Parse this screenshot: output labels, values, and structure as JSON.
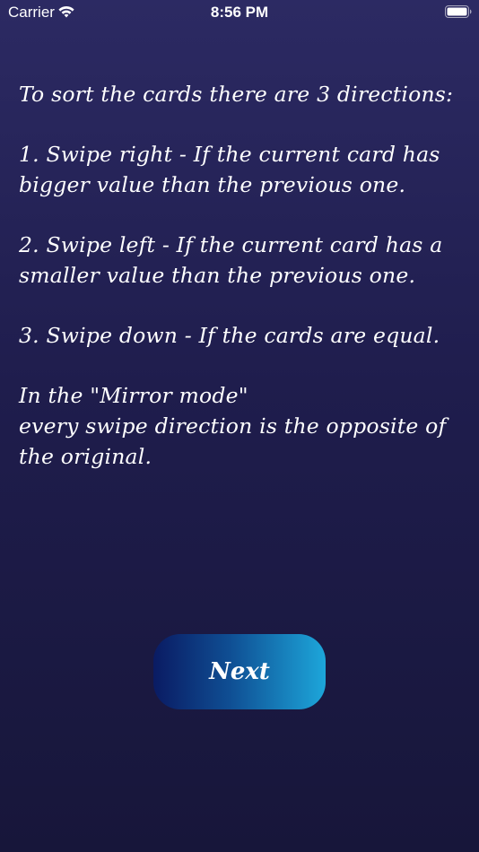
{
  "status_bar": {
    "carrier": "Carrier",
    "time": "8:56 PM",
    "wifi_icon": "wifi-icon",
    "battery_icon": "battery-icon"
  },
  "instructions": {
    "intro": "To sort the cards there are 3 directions:",
    "rule_1": "1. Swipe right - If the current card has bigger value than the previous one.",
    "rule_2": "2. Swipe left - If the current card has a smaller value than the previous one.",
    "rule_3": "3. Swipe down - If the cards are equal.",
    "mirror_line_1": "In the \"Mirror mode\"",
    "mirror_line_2": "every swipe direction is the opposite of the original."
  },
  "next_button": {
    "label": "Next"
  },
  "colors": {
    "background_top": "#2c2a63",
    "background_bottom": "#17163a",
    "button_gradient_start": "#0a1b63",
    "button_gradient_end": "#1da6da"
  }
}
